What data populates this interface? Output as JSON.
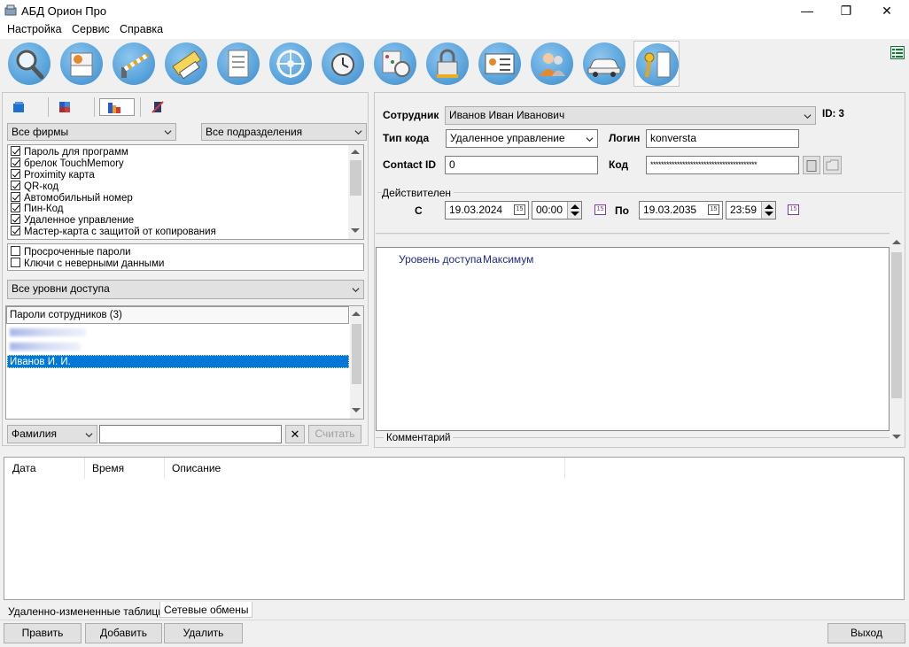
{
  "window": {
    "title": "АБД Орион Про",
    "minimize": "—",
    "maximize": "❐",
    "close": "✕"
  },
  "menu": [
    "Настройка",
    "Сервис",
    "Справка"
  ],
  "toolbar": {
    "icons": [
      "search-icon",
      "printer-icon",
      "barrier-icon",
      "ruler-icon",
      "document-icon",
      "wheel-icon",
      "alarm-clock-icon",
      "schedule-icon",
      "lock-icon",
      "id-card-icon",
      "users-icon",
      "car-icon",
      "key-icon"
    ],
    "active_index": 12
  },
  "left": {
    "view_tabs": [
      "tree-icon",
      "cubes-icon",
      "building-icon",
      "disable-icon"
    ],
    "firms_combo": "Все фирмы",
    "departments_combo": "Все подразделения",
    "key_types": [
      {
        "label": "Пароль для программ",
        "checked": true
      },
      {
        "label": "брелок TouchMemory",
        "checked": true
      },
      {
        "label": "Proximity карта",
        "checked": true
      },
      {
        "label": "QR-код",
        "checked": true
      },
      {
        "label": "Автомобильный номер",
        "checked": true
      },
      {
        "label": "Пин-Код",
        "checked": true
      },
      {
        "label": "Удаленное управление",
        "checked": true
      },
      {
        "label": "Мастер-карта с защитой от копирования",
        "checked": true
      }
    ],
    "extra_filters": [
      {
        "label": "Просроченные пароли",
        "checked": false
      },
      {
        "label": "Ключи с неверными данными",
        "checked": false
      }
    ],
    "access_combo": "Все уровни доступа",
    "list_header": "Пароли сотрудников  (3)",
    "list_items": [
      "Иванов И. И."
    ],
    "search_field_combo": "Фамилия",
    "search_value": "",
    "clear_label": "✕",
    "read_button": "Считать"
  },
  "right": {
    "employee_label": "Сотрудник",
    "employee_value": "Иванов Иван Иванович",
    "id_label": "ID: 3",
    "code_type_label": "Тип кода",
    "code_type_value": "Удаленное управление",
    "login_label": "Логин",
    "login_value": "konversta",
    "contact_label": "Contact ID",
    "contact_value": "0",
    "code_label": "Код",
    "code_value": "****************************************",
    "valid_label": "Действителен",
    "from_label": "С",
    "from_date": "19.03.2024",
    "from_time": "00:00",
    "to_label": "По",
    "to_date": "19.03.2035",
    "to_time": "23:59",
    "cal_glyph": "15",
    "access_level_label": "Уровень доступа",
    "access_level_value": "Максимум",
    "comment_label": "Комментарий"
  },
  "log": {
    "columns": [
      "Дата",
      "Время",
      "Описание"
    ],
    "tabs": [
      "Удаленно-измененные таблицы",
      "Сетевые обмены"
    ]
  },
  "buttons": {
    "edit": "Править",
    "add": "Добавить",
    "delete": "Удалить",
    "exit": "Выход"
  },
  "colors": {
    "selection": "#0078d7",
    "access_text": "#1c2a8c",
    "icon_blue": "#5aa4dc"
  }
}
